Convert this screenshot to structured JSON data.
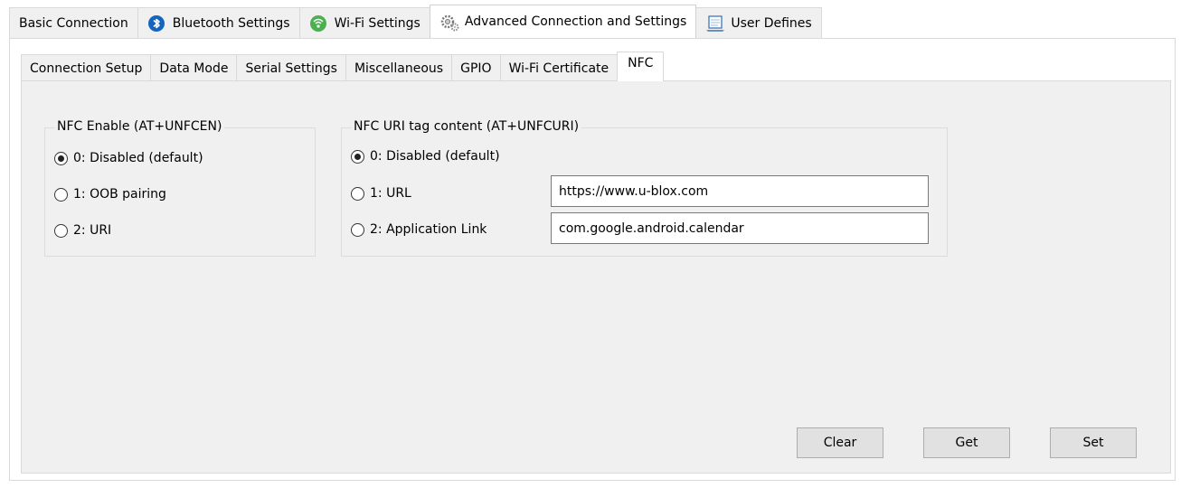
{
  "top_tabs": [
    {
      "label": "Basic Connection",
      "icon": "",
      "active": false
    },
    {
      "label": "Bluetooth Settings",
      "icon": "bluetooth-icon",
      "active": false
    },
    {
      "label": "Wi-Fi Settings",
      "icon": "wifi-icon",
      "active": false
    },
    {
      "label": "Advanced Connection and Settings",
      "icon": "gears-icon",
      "active": true
    },
    {
      "label": "User Defines",
      "icon": "notepad-icon",
      "active": false
    }
  ],
  "sub_tabs": [
    {
      "label": "Connection Setup",
      "active": false
    },
    {
      "label": "Data Mode",
      "active": false
    },
    {
      "label": "Serial Settings",
      "active": false
    },
    {
      "label": "Miscellaneous",
      "active": false
    },
    {
      "label": "GPIO",
      "active": false
    },
    {
      "label": "Wi-Fi Certificate",
      "active": false
    },
    {
      "label": "NFC",
      "active": true
    }
  ],
  "nfc_enable": {
    "title": "NFC Enable (AT+UNFCEN)",
    "options": [
      {
        "label": "0: Disabled (default)",
        "checked": true
      },
      {
        "label": "1: OOB pairing",
        "checked": false
      },
      {
        "label": "2: URI",
        "checked": false
      }
    ]
  },
  "nfc_uri": {
    "title": "NFC URI tag content (AT+UNFCURI)",
    "options": [
      {
        "label": "0: Disabled (default)",
        "checked": true
      },
      {
        "label": "1: URL",
        "checked": false
      },
      {
        "label": "2: Application Link",
        "checked": false
      }
    ],
    "url_value": "https://www.u-blox.com",
    "app_link_value": "com.google.android.calendar"
  },
  "buttons": {
    "clear": "Clear",
    "get": "Get",
    "set": "Set"
  },
  "colors": {
    "panel_bg": "#f0f0f0",
    "tab_border": "#d9d9d9",
    "bluetooth_blue": "#1565c0",
    "wifi_green": "#4caf50"
  }
}
